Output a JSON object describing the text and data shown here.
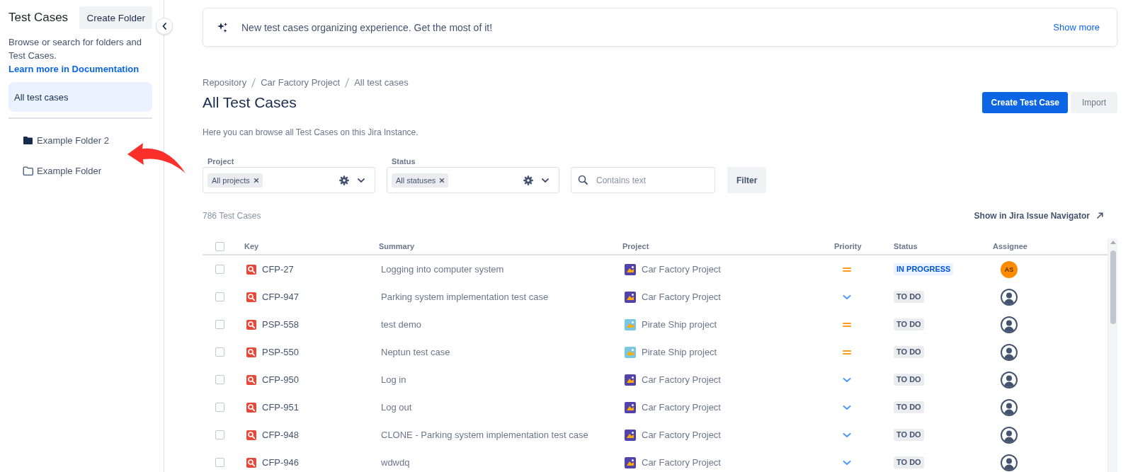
{
  "sidebar": {
    "title": "Test Cases",
    "create_button": "Create Folder",
    "description": "Browse or search for folders and Test Cases.",
    "doc_link": "Learn more in Documentation",
    "all_item": {
      "label": "All test cases",
      "selected": true
    },
    "folders": [
      {
        "name": "Example Folder 2",
        "kind": "filled",
        "selected": false,
        "arrow": true
      },
      {
        "name": "Example Folder",
        "kind": "outline",
        "selected": false,
        "arrow": false
      }
    ]
  },
  "banner": {
    "text": "New test cases organizing experience. Get the most of it!",
    "link": "Show more"
  },
  "page": {
    "breadcrumbs": [
      "Repository",
      "Car Factory Project",
      "All test cases"
    ],
    "title": "All Test Cases",
    "create_button": "Create Test Case",
    "import_button": "Import",
    "description": "Here you can browse all Test Cases on this Jira Instance."
  },
  "filters": {
    "fields": [
      {
        "kind": "select",
        "label": "Project",
        "chips": [
          "All projects"
        ]
      },
      {
        "kind": "select",
        "label": "Status",
        "chips": [
          "All statuses"
        ]
      },
      {
        "kind": "search",
        "placeholder": "Contains text"
      }
    ],
    "button": "Filter"
  },
  "results": {
    "count": "786 Test Cases",
    "navigator_link": "Show in Jira Issue Navigator"
  },
  "table": {
    "select_all": {
      "checked": false
    },
    "columns": [
      "Key",
      "Summary",
      "Project",
      "Priority",
      "Status",
      "Assignee"
    ],
    "rows": [
      {
        "checked": false,
        "key": "CFP-27",
        "summary": "Logging into computer system",
        "project": {
          "name": "Car Factory Project",
          "color": "#5243aa"
        },
        "priority": {
          "kind": "medium"
        },
        "status": {
          "text": "IN PROGRESS",
          "kind": "inprogress"
        },
        "assignee": {
          "kind": "initials",
          "initials": "AS"
        }
      },
      {
        "checked": false,
        "key": "CFP-947",
        "summary": "Parking system implementation test case",
        "project": {
          "name": "Car Factory Project",
          "color": "#5243aa"
        },
        "priority": {
          "kind": "low"
        },
        "status": {
          "text": "TO DO",
          "kind": "todo"
        },
        "assignee": {
          "kind": "unassigned"
        }
      },
      {
        "checked": false,
        "key": "PSP-558",
        "summary": "test demo",
        "project": {
          "name": "Pirate Ship project",
          "color": "#79c7e3"
        },
        "priority": {
          "kind": "medium"
        },
        "status": {
          "text": "TO DO",
          "kind": "todo"
        },
        "assignee": {
          "kind": "unassigned"
        }
      },
      {
        "checked": false,
        "key": "PSP-550",
        "summary": "Neptun test case",
        "project": {
          "name": "Pirate Ship project",
          "color": "#79c7e3"
        },
        "priority": {
          "kind": "medium"
        },
        "status": {
          "text": "TO DO",
          "kind": "todo"
        },
        "assignee": {
          "kind": "unassigned"
        }
      },
      {
        "checked": false,
        "key": "CFP-950",
        "summary": "Log in",
        "project": {
          "name": "Car Factory Project",
          "color": "#5243aa"
        },
        "priority": {
          "kind": "low"
        },
        "status": {
          "text": "TO DO",
          "kind": "todo"
        },
        "assignee": {
          "kind": "unassigned"
        }
      },
      {
        "checked": false,
        "key": "CFP-951",
        "summary": "Log out",
        "project": {
          "name": "Car Factory Project",
          "color": "#5243aa"
        },
        "priority": {
          "kind": "low"
        },
        "status": {
          "text": "TO DO",
          "kind": "todo"
        },
        "assignee": {
          "kind": "unassigned"
        }
      },
      {
        "checked": false,
        "key": "CFP-948",
        "summary": "CLONE - Parking system implementation test case",
        "project": {
          "name": "Car Factory Project",
          "color": "#5243aa"
        },
        "priority": {
          "kind": "low"
        },
        "status": {
          "text": "TO DO",
          "kind": "todo"
        },
        "assignee": {
          "kind": "unassigned"
        }
      },
      {
        "checked": false,
        "key": "CFP-946",
        "summary": "wdwdq",
        "project": {
          "name": "Car Factory Project",
          "color": "#5243aa"
        },
        "priority": {
          "kind": "low"
        },
        "status": {
          "text": "TO DO",
          "kind": "todo"
        },
        "assignee": {
          "kind": "unassigned"
        }
      }
    ]
  }
}
